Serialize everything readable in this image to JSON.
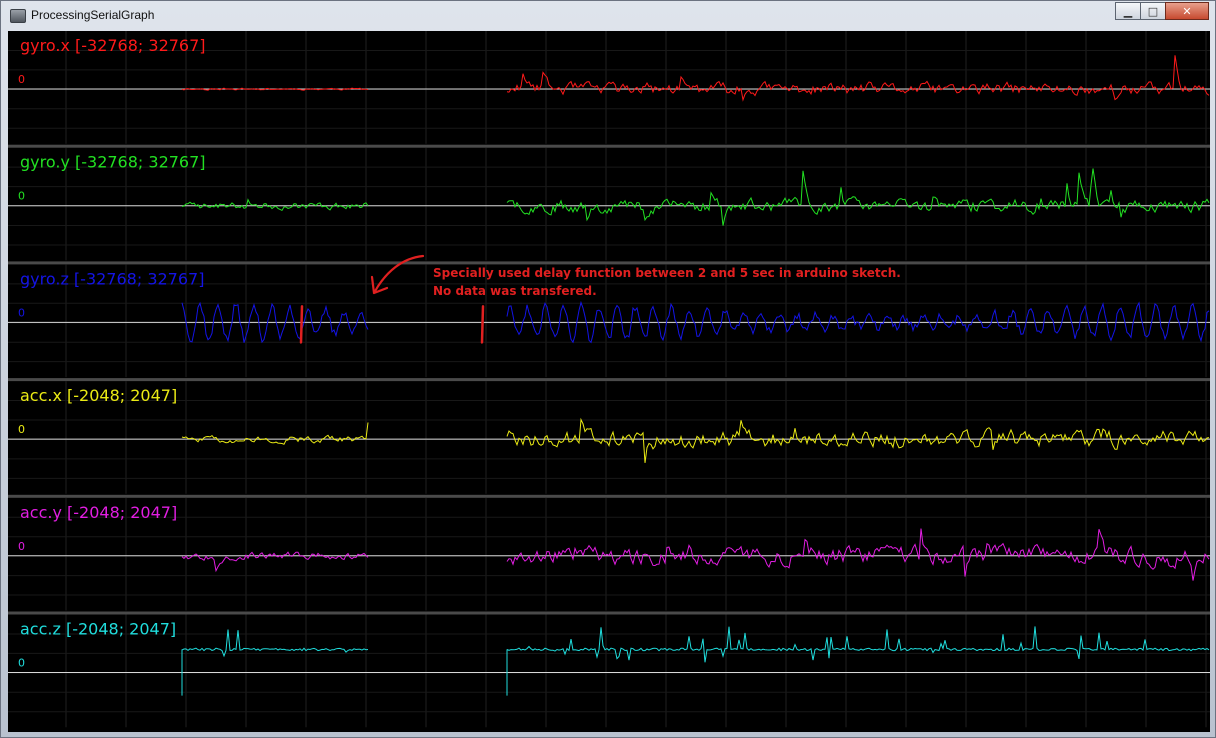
{
  "window": {
    "title": "ProcessingSerialGraph",
    "minimize_icon": "minimize-icon",
    "maximize_icon": "maximize-icon",
    "close_icon": "close-icon"
  },
  "annotation": {
    "line1": "Specially used delay function between 2 and 5 sec in arduino sketch.",
    "line2": "No data was transfered.",
    "color": "#e02020",
    "arrow_icon": "hand-drawn-arrow-icon"
  },
  "chart_data": [
    {
      "type": "line",
      "title": "gyro.x [-32768; 32767]",
      "zero_label": "0",
      "color": "#ff1a1a",
      "ylim": [
        -32768,
        32767
      ],
      "amp": 22000,
      "seed": 11,
      "style": "spiky",
      "segments": [
        [
          0.145,
          0.3,
          0.15
        ],
        [
          0.415,
          1.0,
          0.9
        ]
      ],
      "markers": []
    },
    {
      "type": "line",
      "title": "gyro.y [-32768; 32767]",
      "zero_label": "0",
      "color": "#22e022",
      "ylim": [
        -32768,
        32767
      ],
      "amp": 30000,
      "seed": 23,
      "style": "spiky",
      "segments": [
        [
          0.145,
          0.3,
          0.55
        ],
        [
          0.415,
          1.0,
          1.0
        ]
      ],
      "markers": []
    },
    {
      "type": "line",
      "title": "gyro.z [-32768; 32767]",
      "zero_label": "0",
      "color": "#1414e6",
      "ylim": [
        -32768,
        32767
      ],
      "amp": 5000,
      "seed": 37,
      "style": "wavy",
      "segments": [
        [
          0.145,
          0.3,
          0.9
        ],
        [
          0.415,
          1.0,
          0.8
        ]
      ],
      "markers": [
        0.245,
        0.395
      ]
    },
    {
      "type": "line",
      "title": "acc.x [-2048; 2047]",
      "zero_label": "0",
      "color": "#eaea14",
      "ylim": [
        -2048,
        2047
      ],
      "amp": 900,
      "seed": 51,
      "style": "noisy",
      "segments": [
        [
          0.145,
          0.3,
          0.35
        ],
        [
          0.415,
          1.0,
          0.9
        ]
      ],
      "markers": []
    },
    {
      "type": "line",
      "title": "acc.y [-2048; 2047]",
      "zero_label": "0",
      "color": "#e21ee2",
      "ylim": [
        -2048,
        2047
      ],
      "amp": 550,
      "seed": 67,
      "style": "noisy",
      "segments": [
        [
          0.145,
          0.3,
          0.4
        ],
        [
          0.415,
          1.0,
          0.9
        ]
      ],
      "markers": []
    },
    {
      "type": "line",
      "title": "acc.z [-2048; 2047]",
      "zero_label": "0",
      "color": "#20dede",
      "ylim": [
        -2048,
        2047
      ],
      "amp": 1800,
      "seed": 83,
      "style": "acc",
      "segments": [
        [
          0.145,
          0.3,
          0.4
        ],
        [
          0.415,
          1.0,
          1.0
        ]
      ],
      "markers": []
    }
  ]
}
